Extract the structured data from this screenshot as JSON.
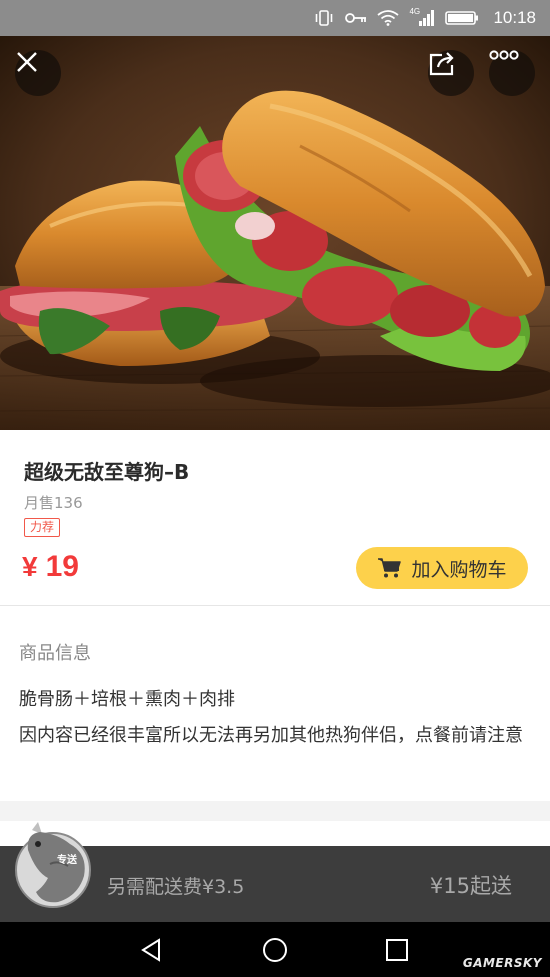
{
  "status_bar": {
    "time": "10:18",
    "icons": [
      "vibrate-icon",
      "key-icon",
      "wifi-icon",
      "signal-4g-icon",
      "battery-icon"
    ],
    "network_label": "4G"
  },
  "header_actions": {
    "close_icon": "close-icon",
    "share_icon": "share-icon",
    "more_icon": "more-icon"
  },
  "product": {
    "name": "超级无敌至尊狗–B",
    "monthly_sales": "月售136",
    "tag": "力荐",
    "currency": "¥",
    "price": "19",
    "add_to_cart_label": "加入购物车",
    "price_color": "#f23a3a",
    "button_color": "#fdd14b"
  },
  "details": {
    "section_title": "商品信息",
    "ingredients": "脆骨肠＋培根＋熏肉＋肉排",
    "note": "因内容已经很丰富所以无法再另加其他热狗伴侣，点餐前请注意"
  },
  "delivery_bar": {
    "badge": "专送",
    "delivery_fee": "另需配送费¥3.5",
    "minimum_order": "¥15起送"
  },
  "nav_bar": {
    "icons": [
      "back-icon",
      "home-icon",
      "recent-apps-icon"
    ]
  },
  "watermark": "GAMERSKY"
}
